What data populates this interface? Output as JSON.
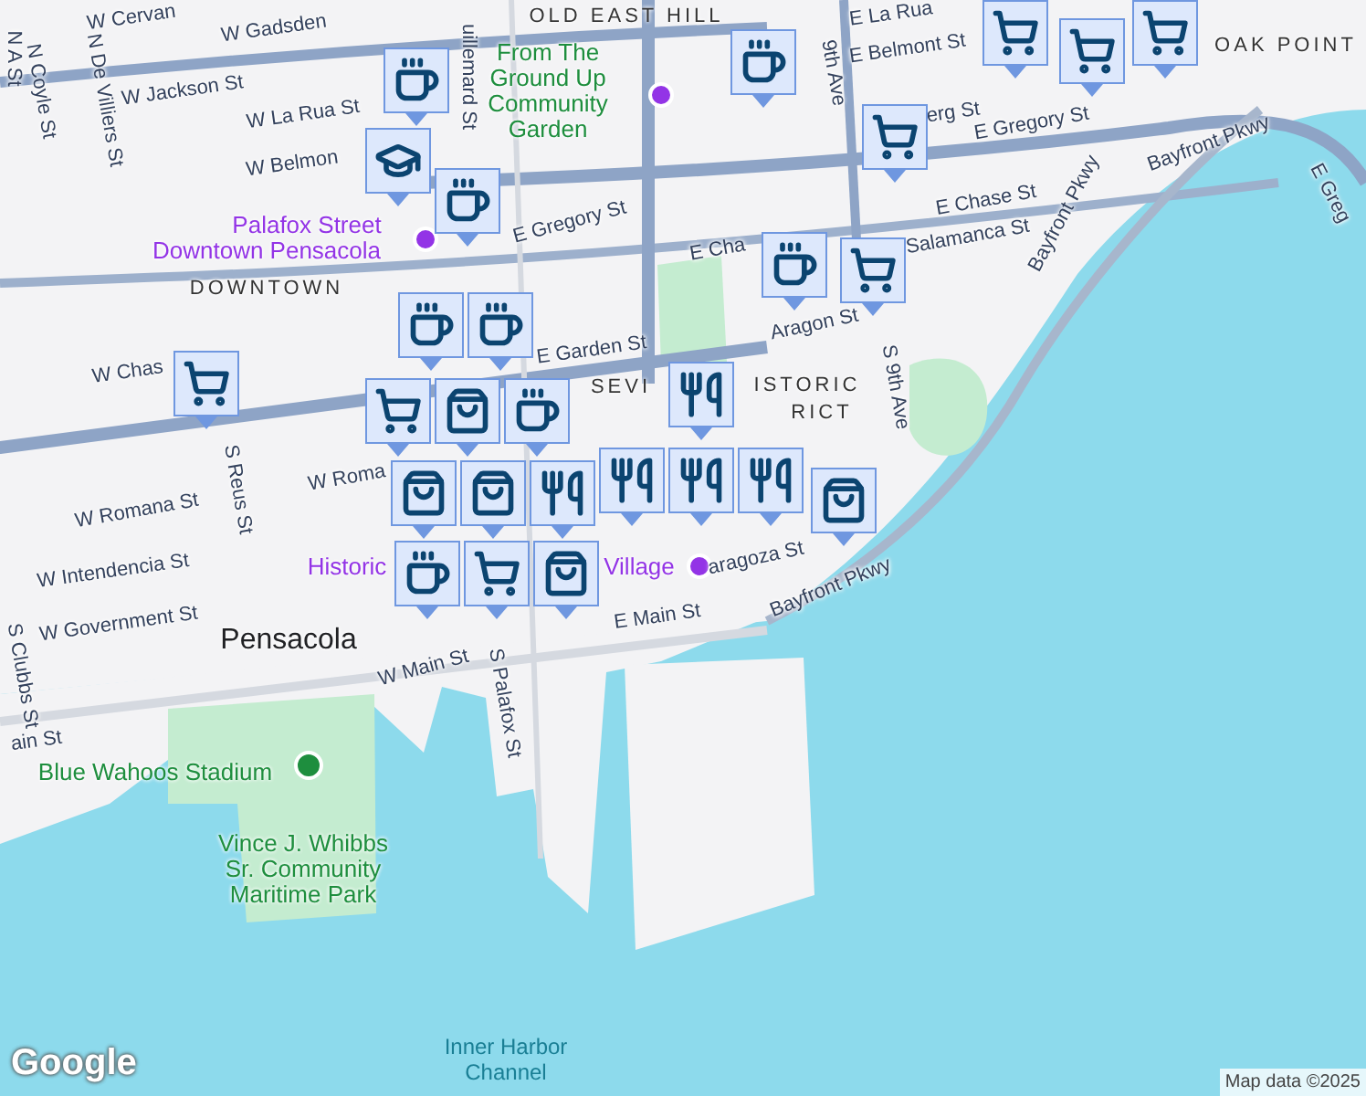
{
  "map": {
    "labels": [
      {
        "kind": "street",
        "text": "W Cervan"
      },
      {
        "kind": "street",
        "text": "W Gadsden"
      },
      {
        "kind": "street",
        "text": "N A St"
      },
      {
        "kind": "street",
        "text": "N Coyle St"
      },
      {
        "kind": "street",
        "text": "N De Villiers St"
      },
      {
        "kind": "street",
        "text": "W Jackson St"
      },
      {
        "kind": "street",
        "text": "W La Rua St"
      },
      {
        "kind": "street",
        "text": "W Belmon"
      },
      {
        "kind": "poi",
        "text": "Palafox Street"
      },
      {
        "kind": "poi",
        "text": "Downtown Pensacola"
      },
      {
        "kind": "district",
        "text": "DOWNTOWN"
      },
      {
        "kind": "street",
        "text": "uillemard St"
      },
      {
        "kind": "street",
        "text": "E Gregory St"
      },
      {
        "kind": "district",
        "text": "OLD EAST HILL"
      },
      {
        "kind": "park",
        "text": "From The Ground Up Community Garden"
      },
      {
        "kind": "street",
        "text": "W Chas"
      },
      {
        "kind": "street",
        "text": "E Garden St"
      },
      {
        "kind": "street",
        "text": "S Reus St"
      },
      {
        "kind": "street",
        "text": "W Romana St"
      },
      {
        "kind": "street",
        "text": "W Roma"
      },
      {
        "kind": "district",
        "text": "SEVI"
      },
      {
        "kind": "district",
        "text": "ISTORIC"
      },
      {
        "kind": "district",
        "text": "RICT"
      },
      {
        "kind": "street",
        "text": "E Belmont St"
      },
      {
        "kind": "street",
        "text": "E La Rua"
      },
      {
        "kind": "street",
        "text": "erg St"
      },
      {
        "kind": "street",
        "text": "E Gregory St"
      },
      {
        "kind": "street",
        "text": "E Chase St"
      },
      {
        "kind": "street",
        "text": "E Cha"
      },
      {
        "kind": "street",
        "text": "Salamanca St"
      },
      {
        "kind": "street",
        "text": "Aragon St"
      },
      {
        "kind": "street",
        "text": "S 9th Ave"
      },
      {
        "kind": "street",
        "text": "9th Ave"
      },
      {
        "kind": "street",
        "text": "Bayfront Pkwy"
      },
      {
        "kind": "street",
        "text": "Bayfront Pkwy"
      },
      {
        "kind": "street",
        "text": "E Greg"
      },
      {
        "kind": "district",
        "text": "OAK POINT"
      },
      {
        "kind": "poi",
        "text": "Historic"
      },
      {
        "kind": "poi",
        "text": "Village"
      },
      {
        "kind": "street",
        "text": "E Main St"
      },
      {
        "kind": "street",
        "text": "aragoza St"
      },
      {
        "kind": "street",
        "text": "Bayfront Pkwy"
      },
      {
        "kind": "street",
        "text": "W Intendencia St"
      },
      {
        "kind": "street",
        "text": "W Government St"
      },
      {
        "kind": "street",
        "text": "S Clubbs St"
      },
      {
        "kind": "city",
        "text": "Pensacola"
      },
      {
        "kind": "street",
        "text": "W Main St"
      },
      {
        "kind": "street",
        "text": "ain St"
      },
      {
        "kind": "street",
        "text": "S Palafox St"
      },
      {
        "kind": "park",
        "text": "Blue Wahoos Stadium"
      },
      {
        "kind": "park",
        "text": "Vince J. Whibbs Sr. Community Maritime Park"
      },
      {
        "kind": "water",
        "text": "Inner Harbor Channel"
      }
    ],
    "markers": [
      {
        "kind": "school"
      },
      {
        "kind": "cafe"
      },
      {
        "kind": "cafe"
      },
      {
        "kind": "cafe"
      },
      {
        "kind": "cart"
      },
      {
        "kind": "cart"
      },
      {
        "kind": "cart"
      },
      {
        "kind": "cart"
      },
      {
        "kind": "cafe"
      },
      {
        "kind": "cart"
      },
      {
        "kind": "cart"
      },
      {
        "kind": "cafe"
      },
      {
        "kind": "cafe"
      },
      {
        "kind": "bag"
      },
      {
        "kind": "cafe"
      },
      {
        "kind": "cart"
      },
      {
        "kind": "bag"
      },
      {
        "kind": "bag"
      },
      {
        "kind": "restaurant"
      },
      {
        "kind": "restaurant"
      },
      {
        "kind": "restaurant"
      },
      {
        "kind": "restaurant"
      },
      {
        "kind": "restaurant"
      },
      {
        "kind": "bag"
      },
      {
        "kind": "cafe"
      },
      {
        "kind": "cart"
      },
      {
        "kind": "bag"
      }
    ]
  },
  "attribution": "Map data ©2025",
  "logo": "Google"
}
